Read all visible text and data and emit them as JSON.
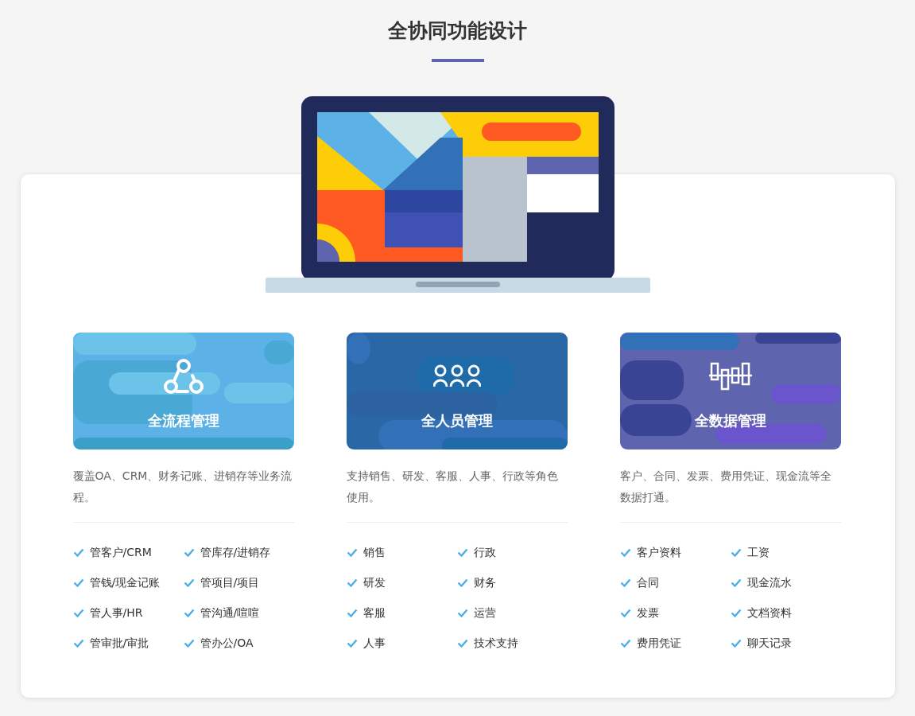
{
  "title": "全协同功能设计",
  "features": [
    {
      "kind": "flow",
      "name": "全流程管理",
      "color": "#5cb2e6",
      "description": "覆盖OA、CRM、财务记账、进销存等业务流程。",
      "items": [
        "管客户/CRM",
        "管库存/进销存",
        "管钱/现金记账",
        "管项目/项目",
        "管人事/HR",
        "管沟通/喧喧",
        "管审批/审批",
        "管办公/OA"
      ]
    },
    {
      "kind": "people",
      "name": "全人员管理",
      "color": "#2a67a6",
      "description": "支持销售、研发、客服、人事、行政等角色使用。",
      "items": [
        "销售",
        "行政",
        "研发",
        "财务",
        "客服",
        "运营",
        "人事",
        "技术支持"
      ]
    },
    {
      "kind": "data",
      "name": "全数据管理",
      "color": "#5e64ae",
      "description": "客户、合同、发票、费用凭证、现金流等全数据打通。",
      "items": [
        "客户资料",
        "工资",
        "合同",
        "现金流水",
        "发票",
        "文档资料",
        "费用凭证",
        "聊天记录"
      ]
    }
  ]
}
